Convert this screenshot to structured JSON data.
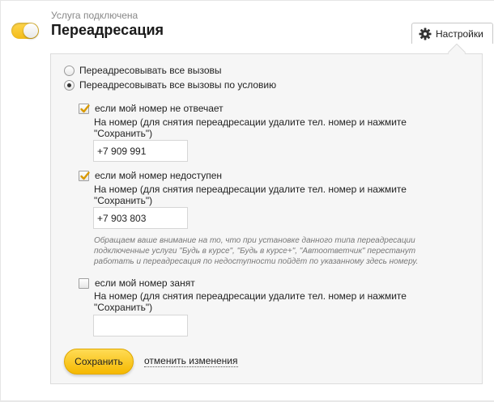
{
  "service": {
    "status_text": "Услуга подключена",
    "title": "Переадресация",
    "toggle_on": true
  },
  "settings": {
    "label": "Настройки",
    "icon": "gear-icon"
  },
  "options": [
    {
      "label": "Переадресовывать все вызовы",
      "selected": false
    },
    {
      "label": "Переадресовывать все вызовы по условию",
      "selected": true
    }
  ],
  "conditions": [
    {
      "label": "если мой номер не отвечает",
      "checked": true,
      "hint": "На номер (для снятия переадресации удалите тел. номер и нажмите \"Сохранить\")",
      "value": "+7 909 991"
    },
    {
      "label": "если мой номер недоступен",
      "checked": true,
      "hint": "На номер (для снятия переадресации удалите тел. номер и нажмите \"Сохранить\")",
      "value": "+7 903 803"
    },
    {
      "label": "если мой номер занят",
      "checked": false,
      "hint": "На номер (для снятия переадресации удалите тел. номер и нажмите \"Сохранить\")",
      "value": ""
    }
  ],
  "note": "Обращаем ваше внимание на то, что при установке данного типа переадресации подключенные услуги \"Будь в курсе\", \"Будь в курсе+\", \"Автоответчик\" перестанут работать и переадресация по недоступности пойдёт по указанному здесь номеру.",
  "actions": {
    "save_label": "Сохранить",
    "cancel_label": "отменить изменения"
  },
  "colors": {
    "accent": "#f5b800",
    "check": "#e0a000"
  }
}
